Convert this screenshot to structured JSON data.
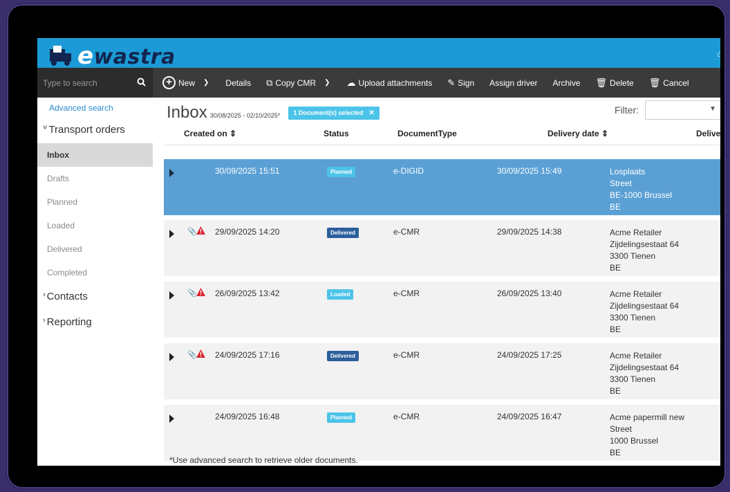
{
  "app": {
    "logo_text": "wastra",
    "logo_e": "e"
  },
  "sidebar": {
    "search_placeholder": "Type to search",
    "advanced_search": "Advanced search",
    "groups": [
      {
        "label": "Transport orders"
      },
      {
        "label": "Contacts"
      },
      {
        "label": "Reporting"
      }
    ],
    "items": [
      {
        "label": "Inbox"
      },
      {
        "label": "Drafts"
      },
      {
        "label": "Planned"
      },
      {
        "label": "Loaded"
      },
      {
        "label": "Delivered"
      },
      {
        "label": "Completed"
      }
    ]
  },
  "toolbar": {
    "new": "New",
    "details": "Details",
    "copy_cmr": "Copy CMR",
    "upload": "Upload attachments",
    "sign": "Sign",
    "assign_driver": "Assign driver",
    "archive": "Archive",
    "delete": "Delete",
    "cancel": "Cancel"
  },
  "main": {
    "title": "Inbox",
    "date_range": "30/08/2025 - 02/10/2025*",
    "selected_badge": "1 Document(s) selected",
    "filter_label": "Filter:",
    "columns": {
      "created_on": "Created on ⇕",
      "status": "Status",
      "document_type": "DocumentType",
      "delivery_date": "Delivery date ⇕",
      "delivery_address": "Delive"
    },
    "rows": [
      {
        "created": "30/09/2025 15:51",
        "status": "Planned",
        "doctype": "e-DIGID",
        "delivery": "30/09/2025 15:49",
        "addr1": "Losplaats",
        "addr2": "Street",
        "addr3": "BE-1000 Brussel",
        "addr4": "BE"
      },
      {
        "created": "29/09/2025 14:20",
        "status": "Delivered",
        "doctype": "e-CMR",
        "delivery": "29/09/2025 14:38",
        "addr1": "Acme Retailer",
        "addr2": "Zijdelingsestaat 64",
        "addr3": "3300 Tienen",
        "addr4": "BE"
      },
      {
        "created": "26/09/2025 13:42",
        "status": "Loaded",
        "doctype": "e-CMR",
        "delivery": "26/09/2025 13:40",
        "addr1": "Acme Retailer",
        "addr2": "Zijdelingsestaat 64",
        "addr3": "3300 Tienen",
        "addr4": "BE"
      },
      {
        "created": "24/09/2025 17:16",
        "status": "Delivered",
        "doctype": "e-CMR",
        "delivery": "24/09/2025 17:25",
        "addr1": "Acme Retailer",
        "addr2": "Zijdelingsestaat 64",
        "addr3": "3300 Tienen",
        "addr4": "BE"
      },
      {
        "created": "24/09/2025 16:48",
        "status": "Planned",
        "doctype": "e-CMR",
        "delivery": "24/09/2025 16:47",
        "addr1": "Acme papermill new",
        "addr2": "Street",
        "addr3": "1000 Brussel",
        "addr4": "BE"
      }
    ],
    "footnote": "*Use advanced search to retrieve older documents."
  },
  "colors": {
    "header": "#1c9ad6",
    "toolbar": "#3b3b3b",
    "selected_row": "#5aa0d4",
    "status_planned": "#4cc3e8",
    "status_delivered": "#2b5e9b",
    "warning": "#d9262f"
  }
}
